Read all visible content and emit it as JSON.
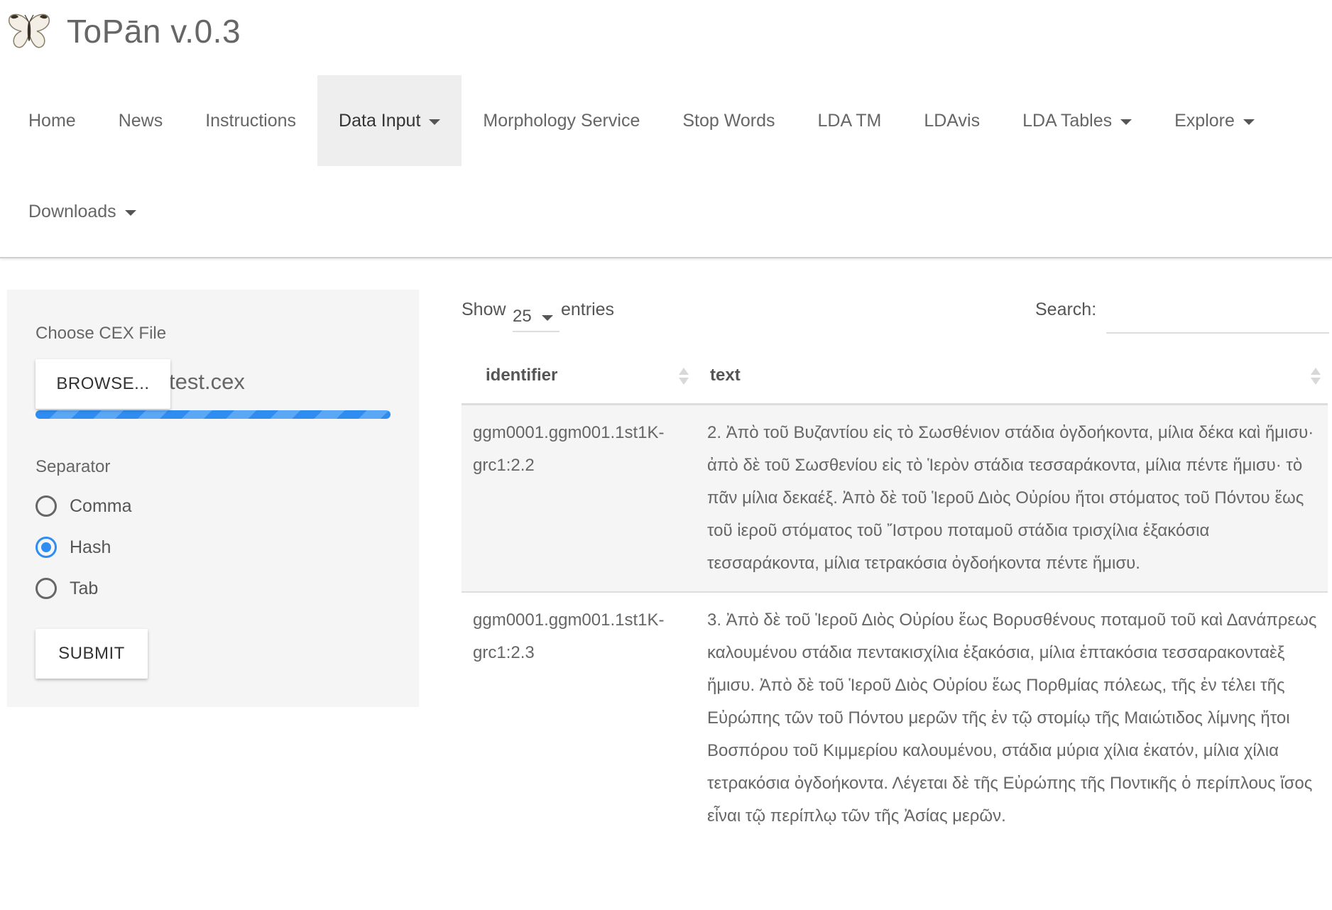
{
  "header": {
    "app_title": "ToPān v.0.3",
    "logo_icon": "butterfly-icon"
  },
  "nav": {
    "items": [
      {
        "label": "Home",
        "dropdown": false
      },
      {
        "label": "News",
        "dropdown": false
      },
      {
        "label": "Instructions",
        "dropdown": false
      },
      {
        "label": "Data Input",
        "dropdown": true,
        "active": true
      },
      {
        "label": "Morphology Service",
        "dropdown": false
      },
      {
        "label": "Stop Words",
        "dropdown": false
      },
      {
        "label": "LDA TM",
        "dropdown": false
      },
      {
        "label": "LDAvis",
        "dropdown": false
      },
      {
        "label": "LDA Tables",
        "dropdown": true
      },
      {
        "label": "Explore",
        "dropdown": true
      },
      {
        "label": "Downloads",
        "dropdown": true
      }
    ]
  },
  "sidebar": {
    "file_label": "Choose CEX File",
    "browse_label": "BROWSE...",
    "file_name": "test.cex",
    "upload_progress": 1.0,
    "separator_label": "Separator",
    "separator_options": [
      {
        "label": "Comma",
        "checked": false
      },
      {
        "label": "Hash",
        "checked": true
      },
      {
        "label": "Tab",
        "checked": false
      }
    ],
    "submit_label": "SUBMIT"
  },
  "table": {
    "show_label": "Show",
    "length_value": "25",
    "entries_label": "entries",
    "search_label": "Search:",
    "search_value": "",
    "columns": [
      "identifier",
      "text"
    ],
    "rows": [
      {
        "identifier": "ggm0001.ggm001.1st1K-grc1:2.2",
        "text": "2. Ἀπὸ τοῦ Βυζαντίου εἰς τὸ Σωσθένιον στάδια ὀγδοήκοντα, μίλια δέκα καὶ ἥμισυ· ἀπὸ δὲ τοῦ Σωσθενίου εἰς τὸ Ἱερὸν στάδια τεσσαράκοντα, μίλια πέντε ἥμισυ· τὸ πᾶν μίλια δεκαέξ. Ἀπὸ δὲ τοῦ Ἱεροῦ Διὸς Οὐρίου ἤτοι στόματος τοῦ Πόντου ἕως τοῦ ἱεροῦ στόματος τοῦ Ἴστρου ποταμοῦ στάδια τρισχίλια ἑξακόσια τεσσαράκοντα, μίλια τετρακόσια ὀγδοήκοντα πέντε ἥμισυ."
      },
      {
        "identifier": "ggm0001.ggm001.1st1K-grc1:2.3",
        "text": "3. Ἀπὸ δὲ τοῦ Ἱεροῦ Διὸς Οὐρίου ἕως Βορυσθένους ποταμοῦ τοῦ καὶ Δανάπρεως καλουμένου στάδια πεντακισχίλια ἑξακόσια, μίλια ἑπτακόσια τεσσαρακονταὲξ ἥμισυ. Ἀπὸ δὲ τοῦ Ἱεροῦ Διὸς Οὐρίου ἕως Πορθμίας πόλεως, τῆς ἐν τέλει τῆς Εὐρώπης τῶν τοῦ Πόντου μερῶν τῆς ἐν τῷ στομίῳ τῆς Μαιώτιδος λίμνης ἤτοι Βοσπόρου τοῦ Κιμμερίου καλουμένου, στάδια μύρια χίλια ἑκατόν, μίλια χίλια τετρακόσια ὀγδοήκοντα. Λέγεται δὲ τῆς Εὐρώπης τῆς Ποντικῆς ὁ περίπλους ἴσος εἶναι τῷ περίπλῳ τῶν τῆς Ἀσίας μερῶν."
      }
    ]
  },
  "colors": {
    "accent": "#2f8cf0",
    "sidebar_bg": "#f5f5f5",
    "active_nav_bg": "#eeeeee"
  }
}
